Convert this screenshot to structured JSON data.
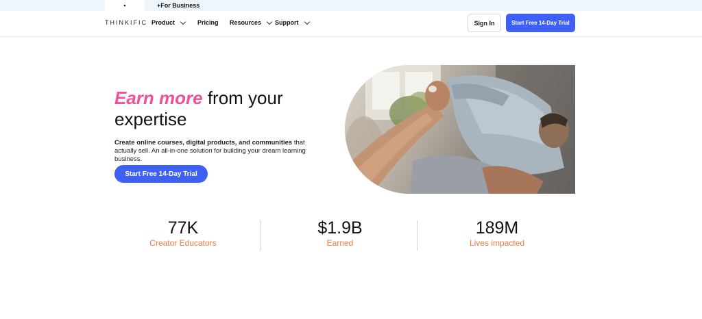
{
  "topbar": {
    "creator_mark": "•",
    "business_label": "+For Business"
  },
  "nav": {
    "logo": "THINKIFIC",
    "items": [
      {
        "label": "Product",
        "has_dropdown": true
      },
      {
        "label": "Pricing",
        "has_dropdown": false
      },
      {
        "label": "Resources",
        "has_dropdown": true
      },
      {
        "label": "Support",
        "has_dropdown": true
      }
    ],
    "signin_label": "Sign In",
    "trial_label": "Start Free 14-Day Trial"
  },
  "hero": {
    "heading_accent": "Earn more",
    "heading_rest": " from your expertise",
    "sub_bold": "Create online courses, digital products, and communities",
    "sub_rest": " that actually sell. An all-in-one solution for building your dream learning business.",
    "cta_label": "Start Free 14-Day Trial"
  },
  "stats": [
    {
      "value": "77K",
      "label": "Creator Educators"
    },
    {
      "value": "$1.9B",
      "label": "Earned"
    },
    {
      "value": "189M",
      "label": "Lives impacted"
    }
  ],
  "colors": {
    "accent_pink": "#f0509a",
    "brand_blue": "#3f60f5",
    "stat_orange": "#f07838",
    "topbar_bg": "#eef6fc"
  }
}
